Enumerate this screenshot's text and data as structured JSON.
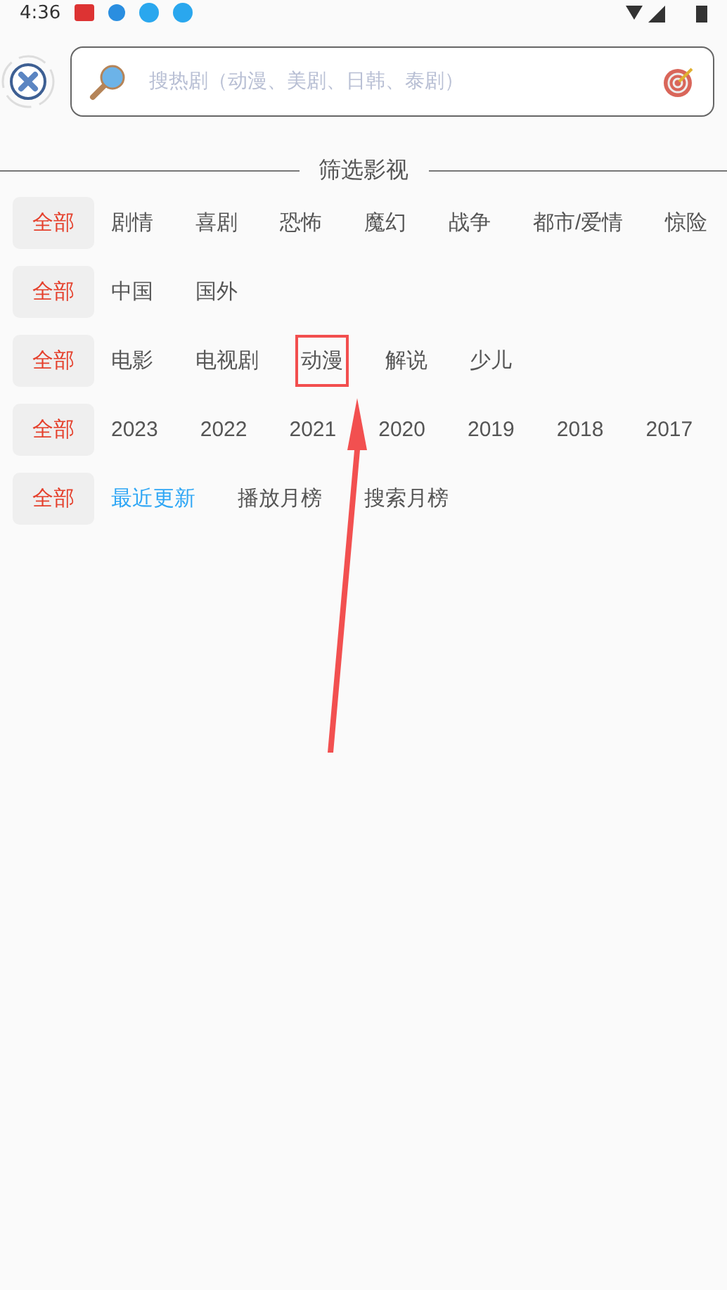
{
  "status_bar": {
    "time": "4:36"
  },
  "search": {
    "placeholder": "搜热剧（动漫、美剧、日韩、泰剧）"
  },
  "filter_title": "筛选影视",
  "filter_rows": [
    {
      "items": [
        {
          "label": "全部",
          "selected": true,
          "highlighted": false
        },
        {
          "label": "剧情",
          "selected": false,
          "highlighted": false
        },
        {
          "label": "喜剧",
          "selected": false,
          "highlighted": false
        },
        {
          "label": "恐怖",
          "selected": false,
          "highlighted": false
        },
        {
          "label": "魔幻",
          "selected": false,
          "highlighted": false
        },
        {
          "label": "战争",
          "selected": false,
          "highlighted": false
        },
        {
          "label": "都市/爱情",
          "selected": false,
          "highlighted": false
        },
        {
          "label": "惊险",
          "selected": false,
          "highlighted": false
        }
      ]
    },
    {
      "items": [
        {
          "label": "全部",
          "selected": true,
          "highlighted": false
        },
        {
          "label": "中国",
          "selected": false,
          "highlighted": false
        },
        {
          "label": "国外",
          "selected": false,
          "highlighted": false
        }
      ]
    },
    {
      "items": [
        {
          "label": "全部",
          "selected": true,
          "highlighted": false
        },
        {
          "label": "电影",
          "selected": false,
          "highlighted": false
        },
        {
          "label": "电视剧",
          "selected": false,
          "highlighted": false
        },
        {
          "label": "动漫",
          "selected": false,
          "highlighted": true
        },
        {
          "label": "解说",
          "selected": false,
          "highlighted": false
        },
        {
          "label": "少儿",
          "selected": false,
          "highlighted": false
        }
      ]
    },
    {
      "items": [
        {
          "label": "全部",
          "selected": true,
          "highlighted": false
        },
        {
          "label": "2023",
          "selected": false,
          "highlighted": false
        },
        {
          "label": "2022",
          "selected": false,
          "highlighted": false
        },
        {
          "label": "2021",
          "selected": false,
          "highlighted": false
        },
        {
          "label": "2020",
          "selected": false,
          "highlighted": false
        },
        {
          "label": "2019",
          "selected": false,
          "highlighted": false
        },
        {
          "label": "2018",
          "selected": false,
          "highlighted": false
        },
        {
          "label": "2017",
          "selected": false,
          "highlighted": false
        }
      ]
    },
    {
      "items": [
        {
          "label": "全部",
          "selected": true,
          "highlighted": false
        },
        {
          "label": "最近更新",
          "selected": false,
          "highlighted": false,
          "color": "#2ea6f5"
        },
        {
          "label": "播放月榜",
          "selected": false,
          "highlighted": false
        },
        {
          "label": "搜索月榜",
          "selected": false,
          "highlighted": false
        }
      ]
    }
  ]
}
